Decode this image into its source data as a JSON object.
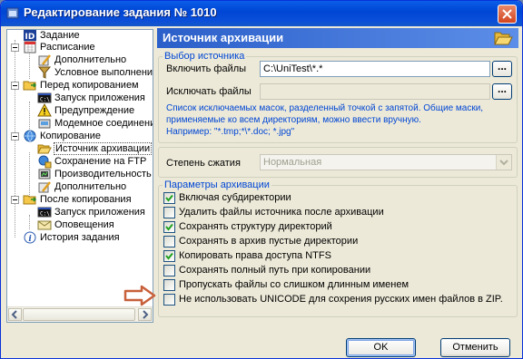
{
  "window": {
    "title": "Редактирование задания № 1010"
  },
  "tree": {
    "items": [
      {
        "label": "Задание",
        "icon": "id-card-icon"
      },
      {
        "label": "Расписание",
        "icon": "calendar-icon"
      },
      {
        "label": "Дополнительно",
        "icon": "settings-pencil-icon"
      },
      {
        "label": "Условное выполнение",
        "icon": "filter-icon"
      },
      {
        "label": "Перед копированием",
        "icon": "folder-arrow-icon"
      },
      {
        "label": "Запуск приложения",
        "icon": "console-icon"
      },
      {
        "label": "Предупреждение",
        "icon": "warning-icon"
      },
      {
        "label": "Модемное соединение",
        "icon": "modem-icon"
      },
      {
        "label": "Копирование",
        "icon": "copy-globe-icon"
      },
      {
        "label": "Источник архивации",
        "icon": "open-folder-icon"
      },
      {
        "label": "Сохранение на FTP",
        "icon": "ftp-icon"
      },
      {
        "label": "Производительность",
        "icon": "performance-icon"
      },
      {
        "label": "Дополнительно",
        "icon": "settings-pencil-icon"
      },
      {
        "label": "После копирования",
        "icon": "folder-arrow-icon"
      },
      {
        "label": "Запуск приложения",
        "icon": "console-icon"
      },
      {
        "label": "Оповещения",
        "icon": "mail-icon"
      },
      {
        "label": "История задания",
        "icon": "info-icon"
      }
    ]
  },
  "panel": {
    "title": "Источник архивации",
    "source_group": {
      "legend": "Выбор источника",
      "include_label": "Включить файлы",
      "include_value": "C:\\UniTest\\*.*",
      "exclude_label": "Исключать файлы",
      "exclude_value": "",
      "browse_label": "...",
      "hint_line1": "Список исключаемых масок, разделенный точкой с запятой. Общие маски,",
      "hint_line2": "применяемые ко всем директориям, можно ввести вручную.",
      "hint_line3": "Например: \"*.tmp;*\\*.doc; *.jpg\""
    },
    "compression": {
      "label": "Степень сжатия",
      "value": "Нормальная"
    },
    "params_group": {
      "legend": "Параметры архивации",
      "options": [
        {
          "label": "Включая субдиректории",
          "checked": true
        },
        {
          "label": "Удалить файлы источника после архивации",
          "checked": false
        },
        {
          "label": "Сохранять структуру директорий",
          "checked": true
        },
        {
          "label": "Сохранять в архив пустые директории",
          "checked": false
        },
        {
          "label": "Копировать права доступа NTFS",
          "checked": true
        },
        {
          "label": "Сохранять полный путь при копировании",
          "checked": false
        },
        {
          "label": "Пропускать файлы со слишком длинным именем",
          "checked": false
        },
        {
          "label": "Не использовать UNICODE для сохрения русских имен файлов в ZIP.",
          "checked": false
        }
      ]
    }
  },
  "buttons": {
    "ok": "OK",
    "cancel": "Отменить"
  },
  "colors": {
    "titlebar": "#0054e3",
    "panel_header": "#3d6fd6",
    "hint_text": "#0046d5",
    "arrow": "#c8603a"
  }
}
